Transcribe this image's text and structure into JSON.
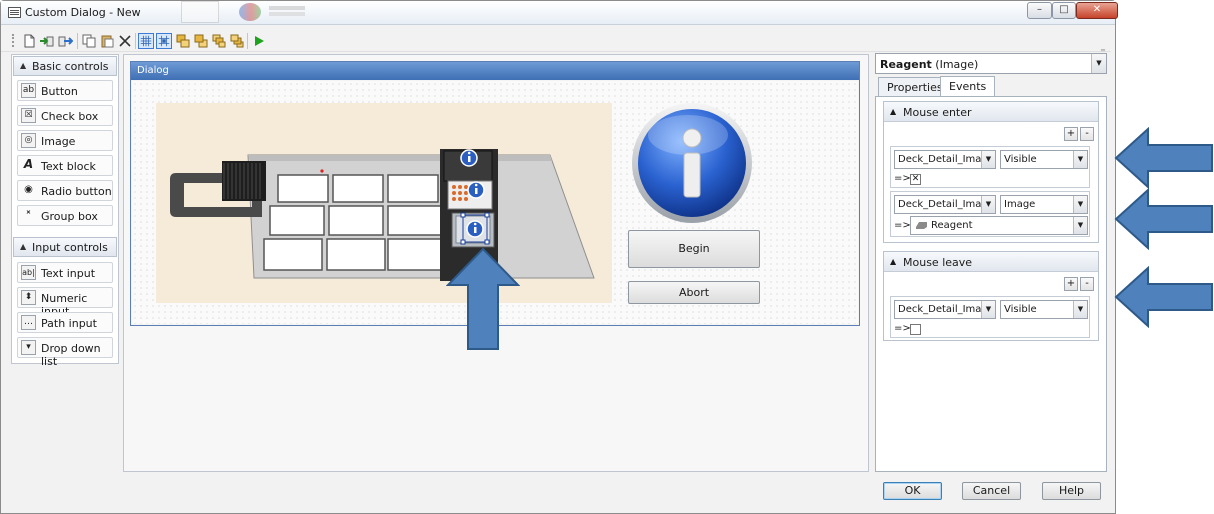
{
  "window": {
    "title": "Custom Dialog - New"
  },
  "window_controls": {
    "minimize": "–",
    "maximize": "□",
    "close": "✕"
  },
  "toolbar": {
    "buttons": [
      "new-file-icon",
      "import-icon",
      "export-icon",
      "copy-icon",
      "paste-icon",
      "delete-icon",
      "grid-icon",
      "snap-icon",
      "bring-to-front-icon",
      "send-to-back-icon",
      "bring-forward-icon",
      "send-backward-icon",
      "run-icon"
    ],
    "run_color": "#1fa21f"
  },
  "toolbox": {
    "basic_title": "Basic controls",
    "basic_items": [
      {
        "label": "Button",
        "icon": "ab"
      },
      {
        "label": "Check box",
        "icon": "☒"
      },
      {
        "label": "Image",
        "icon": "◎"
      },
      {
        "label": "Text block",
        "icon": "A"
      },
      {
        "label": "Radio button",
        "icon": "◉"
      },
      {
        "label": "Group box",
        "icon": "ˣ"
      }
    ],
    "input_title": "Input controls",
    "input_items": [
      {
        "label": "Text input",
        "icon": "ab|"
      },
      {
        "label": "Numeric input",
        "icon": "⬍"
      },
      {
        "label": "Path input",
        "icon": "…"
      },
      {
        "label": "Drop down list",
        "icon": "▾"
      }
    ]
  },
  "dialog": {
    "title": "Dialog",
    "begin_label": "Begin",
    "abort_label": "Abort"
  },
  "inspector": {
    "object_name": "Reagent",
    "object_type": "(Image)",
    "tabs": [
      "Properties",
      "Events"
    ],
    "active_tab": "Events",
    "mouse_enter": {
      "title": "Mouse enter",
      "actions": [
        {
          "target": "Deck_Detail_Image",
          "property": "Visible",
          "arrow": "=>",
          "value_checked": true
        },
        {
          "target": "Deck_Detail_Image",
          "property": "Image",
          "arrow": "=>",
          "value": "Reagent"
        }
      ]
    },
    "mouse_leave": {
      "title": "Mouse leave",
      "actions": [
        {
          "target": "Deck_Detail_Image",
          "property": "Visible",
          "arrow": "=>",
          "value_checked": false
        }
      ]
    }
  },
  "footer": {
    "ok": "OK",
    "cancel": "Cancel",
    "help": "Help"
  },
  "colors": {
    "callout_arrow": "#4f81bd",
    "callout_border": "#2e5a8a",
    "dialog_title": "#4a7ac0"
  }
}
